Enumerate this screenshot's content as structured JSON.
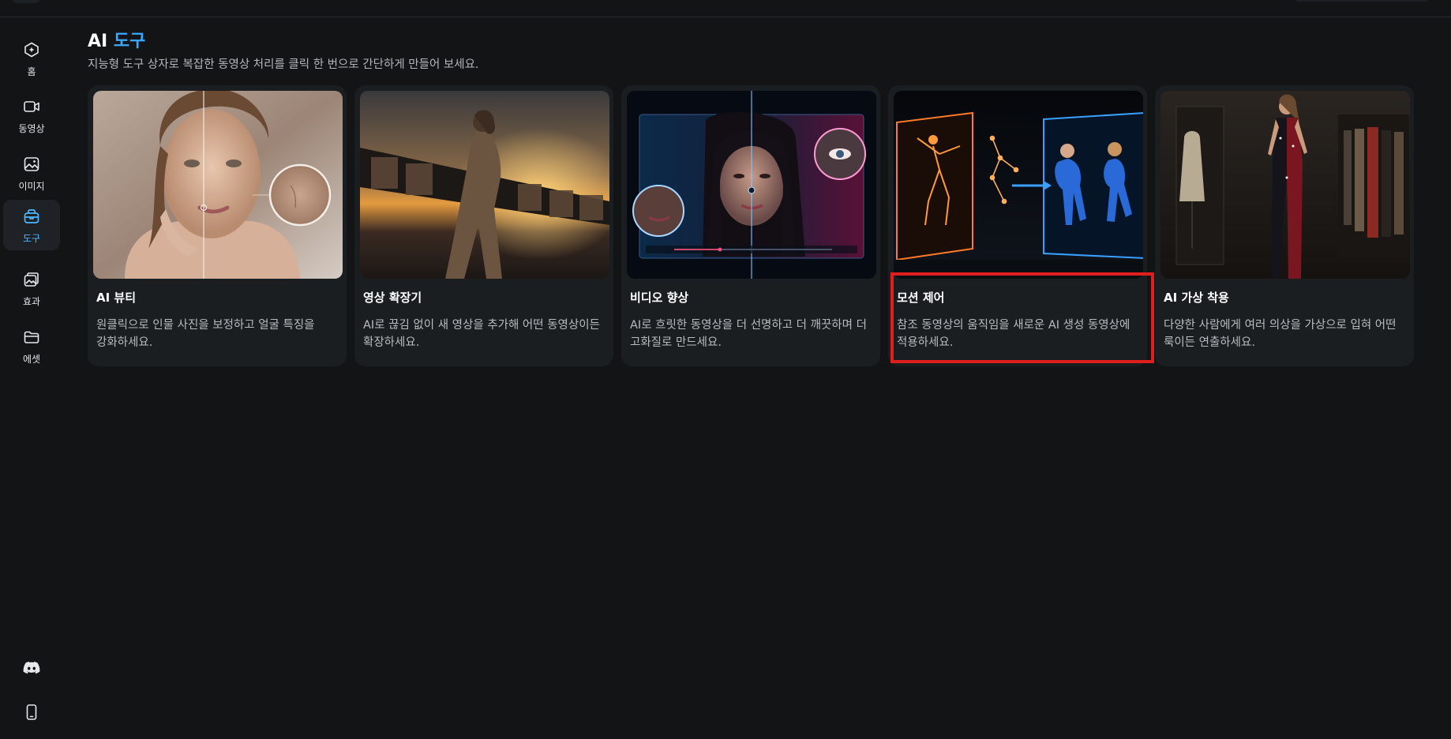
{
  "sidebar": {
    "items": [
      {
        "label": "홈",
        "icon": "home-icon"
      },
      {
        "label": "동영상",
        "icon": "video-icon"
      },
      {
        "label": "이미지",
        "icon": "image-icon"
      },
      {
        "label": "도구",
        "icon": "tools-icon",
        "active": true
      },
      {
        "label": "효과",
        "icon": "effects-icon"
      },
      {
        "label": "에셋",
        "icon": "folder-icon"
      }
    ],
    "bottom": [
      {
        "icon": "discord-icon"
      },
      {
        "icon": "mobile-phone-icon"
      }
    ]
  },
  "header": {
    "title_part1": "AI",
    "title_part2": "도구",
    "subtitle": "지능형 도구 상자로 복잡한 동영상 처리를 클릭 한 번으로 간단하게 만들어 보세요."
  },
  "cards": [
    {
      "title": "AI 뷰티",
      "description": "원클릭으로 인물 사진을 보정하고 얼굴 특징을 강화하세요."
    },
    {
      "title": "영상 확장기",
      "description": "AI로 끊김 없이 새 영상을 추가해 어떤 동영상이든 확장하세요."
    },
    {
      "title": "비디오 향상",
      "description": "AI로 흐릿한 동영상을 더 선명하고 더 깨끗하며 더 고화질로 만드세요."
    },
    {
      "title": "모션 제어",
      "description": "참조 동영상의 움직임을 새로운 AI 생성 동영상에 적용하세요.",
      "highlighted": true
    },
    {
      "title": "AI 가상 착용",
      "description": "다양한 사람에게 여러 의상을 가상으로 입혀 어떤 룩이든 연출하세요."
    }
  ],
  "colors": {
    "background": "#121416",
    "card": "#1b1e21",
    "accent": "#3aa8ff",
    "highlight_border": "#e01e1e"
  }
}
